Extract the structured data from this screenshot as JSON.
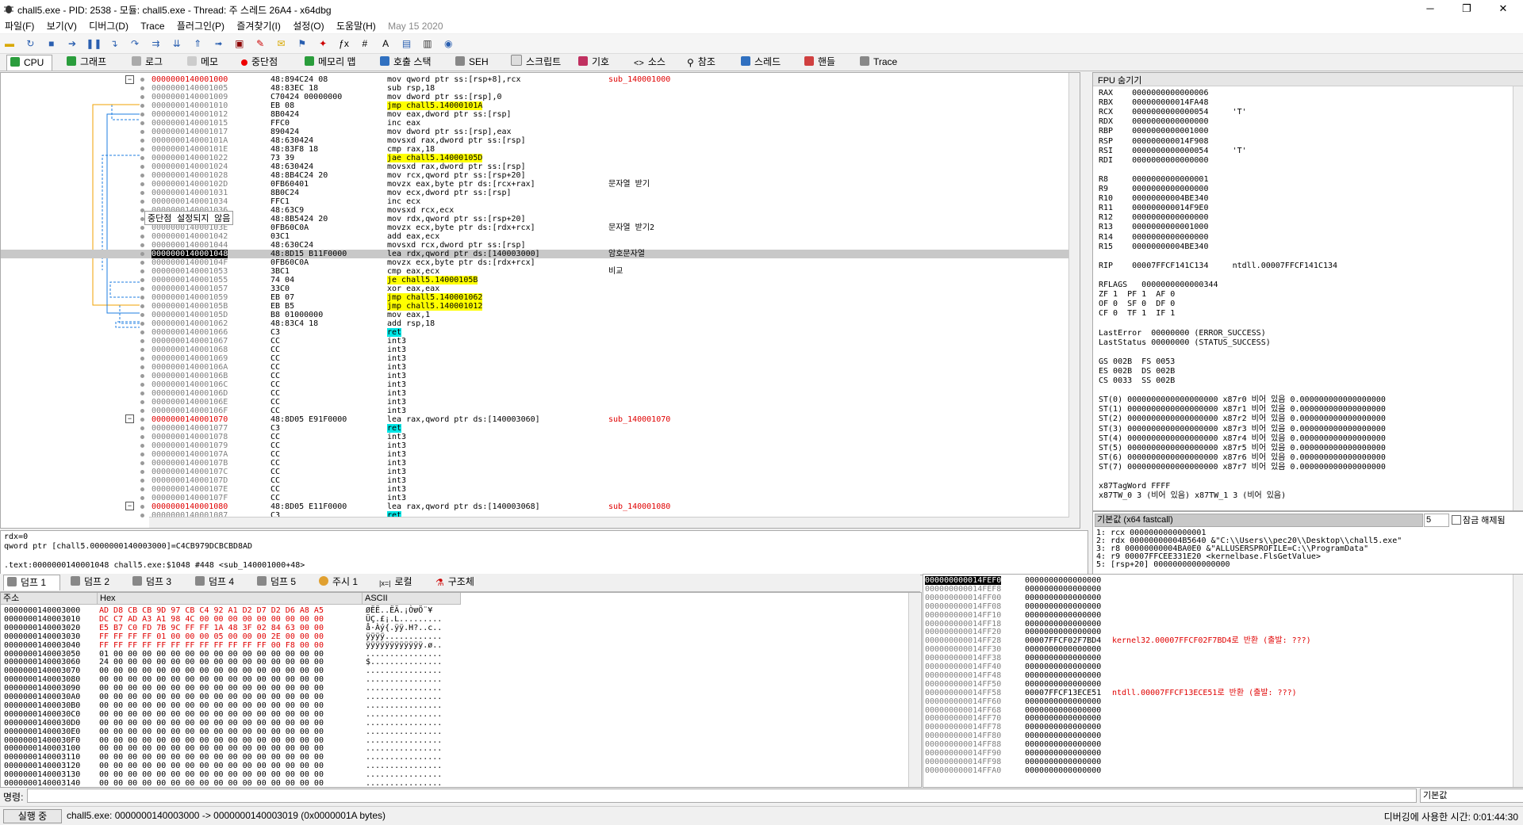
{
  "window": {
    "title": "chall5.exe - PID: 2538 - 모듈: chall5.exe - Thread: 주 스레드 26A4 - x64dbg"
  },
  "menu": [
    "파일(F)",
    "보기(V)",
    "디버그(D)",
    "Trace",
    "플러그인(P)",
    "즐겨찾기(I)",
    "설정(O)",
    "도움말(H)",
    "May 15 2020"
  ],
  "tabs": [
    "CPU",
    "그래프",
    "로그",
    "메모",
    "중단점",
    "메모리 맵",
    "호출 스택",
    "SEH",
    "스크립트",
    "기호",
    "소스",
    "참조",
    "스레드",
    "핸들",
    "Trace"
  ],
  "disasm": [
    {
      "addr": "0000000140001000",
      "bytes": "48:894C24 08",
      "instr": "mov qword ptr ss:[rsp+8],rcx",
      "cmt": "sub_140001000",
      "a": "red"
    },
    {
      "addr": "0000000140001005",
      "bytes": "48:83EC 18",
      "instr": "sub rsp,18",
      "cmt": ""
    },
    {
      "addr": "0000000140001009",
      "bytes": "C70424 00000000",
      "instr": "mov dword ptr ss:[rsp],0",
      "cmt": ""
    },
    {
      "addr": "0000000140001010",
      "bytes": "EB 08",
      "instr": "jmp chall5.14000101A",
      "cmt": "",
      "h": "yellow"
    },
    {
      "addr": "0000000140001012",
      "bytes": "8B0424",
      "instr": "mov eax,dword ptr ss:[rsp]",
      "cmt": ""
    },
    {
      "addr": "0000000140001015",
      "bytes": "FFC0",
      "instr": "inc eax",
      "cmt": ""
    },
    {
      "addr": "0000000140001017",
      "bytes": "890424",
      "instr": "mov dword ptr ss:[rsp],eax",
      "cmt": ""
    },
    {
      "addr": "000000014000101A",
      "bytes": "48:630424",
      "instr": "movsxd rax,dword ptr ss:[rsp]",
      "cmt": ""
    },
    {
      "addr": "000000014000101E",
      "bytes": "48:83F8 18",
      "instr": "cmp rax,18",
      "cmt": ""
    },
    {
      "addr": "0000000140001022",
      "bytes": "73 39",
      "instr": "jae chall5.14000105D",
      "cmt": "",
      "h": "yellow"
    },
    {
      "addr": "0000000140001024",
      "bytes": "48:630424",
      "instr": "movsxd rax,dword ptr ss:[rsp]",
      "cmt": ""
    },
    {
      "addr": "0000000140001028",
      "bytes": "48:8B4C24 20",
      "instr": "mov rcx,qword ptr ss:[rsp+20]",
      "cmt": ""
    },
    {
      "addr": "000000014000102D",
      "bytes": "0FB60401",
      "instr": "movzx eax,byte ptr ds:[rcx+rax]",
      "cmt": "문자열 받기"
    },
    {
      "addr": "0000000140001031",
      "bytes": "8B0C24",
      "instr": "mov ecx,dword ptr ss:[rsp]",
      "cmt": ""
    },
    {
      "addr": "0000000140001034",
      "bytes": "FFC1",
      "instr": "inc ecx",
      "cmt": ""
    },
    {
      "addr": "0000000140001036",
      "bytes": "48:63C9",
      "instr": "movsxd rcx,ecx",
      "cmt": ""
    },
    {
      "addr": "0000000140001039",
      "bytes": "48:8B5424 20",
      "instr": "mov rdx,qword ptr ss:[rsp+20]",
      "cmt": ""
    },
    {
      "addr": "000000014000103E",
      "bytes": "0FB60C0A",
      "instr": "movzx ecx,byte ptr ds:[rdx+rcx]",
      "cmt": "문자열 받기2"
    },
    {
      "addr": "0000000140001042",
      "bytes": "03C1",
      "instr": "add eax,ecx",
      "cmt": ""
    },
    {
      "addr": "0000000140001044",
      "bytes": "48:630C24",
      "instr": "movsxd rcx,dword ptr ss:[rsp]",
      "cmt": ""
    },
    {
      "addr": "0000000140001048",
      "bytes": "48:8D15 B11F0000",
      "instr": "lea rdx,qword ptr ds:[140003000]",
      "cmt": "암호문자열",
      "a": "blk",
      "sel": true
    },
    {
      "addr": "000000014000104F",
      "bytes": "0FB60C0A",
      "instr": "movzx ecx,byte ptr ds:[rdx+rcx]",
      "cmt": ""
    },
    {
      "addr": "0000000140001053",
      "bytes": "3BC1",
      "instr": "cmp eax,ecx",
      "cmt": "비교"
    },
    {
      "addr": "0000000140001055",
      "bytes": "74 04",
      "instr": "je chall5.14000105B",
      "cmt": "",
      "h": "yellow"
    },
    {
      "addr": "0000000140001057",
      "bytes": "33C0",
      "instr": "xor eax,eax",
      "cmt": ""
    },
    {
      "addr": "0000000140001059",
      "bytes": "EB 07",
      "instr": "jmp chall5.140001062",
      "cmt": "",
      "h": "yellow"
    },
    {
      "addr": "000000014000105B",
      "bytes": "EB B5",
      "instr": "jmp chall5.140001012",
      "cmt": "",
      "h": "yellow"
    },
    {
      "addr": "000000014000105D",
      "bytes": "B8 01000000",
      "instr": "mov eax,1",
      "cmt": ""
    },
    {
      "addr": "0000000140001062",
      "bytes": "48:83C4 18",
      "instr": "add rsp,18",
      "cmt": ""
    },
    {
      "addr": "0000000140001066",
      "bytes": "C3",
      "instr": "ret",
      "cmt": "",
      "h": "cyan"
    },
    {
      "addr": "0000000140001067",
      "bytes": "CC",
      "instr": "int3",
      "cmt": ""
    },
    {
      "addr": "0000000140001068",
      "bytes": "CC",
      "instr": "int3",
      "cmt": ""
    },
    {
      "addr": "0000000140001069",
      "bytes": "CC",
      "instr": "int3",
      "cmt": ""
    },
    {
      "addr": "000000014000106A",
      "bytes": "CC",
      "instr": "int3",
      "cmt": ""
    },
    {
      "addr": "000000014000106B",
      "bytes": "CC",
      "instr": "int3",
      "cmt": ""
    },
    {
      "addr": "000000014000106C",
      "bytes": "CC",
      "instr": "int3",
      "cmt": ""
    },
    {
      "addr": "000000014000106D",
      "bytes": "CC",
      "instr": "int3",
      "cmt": ""
    },
    {
      "addr": "000000014000106E",
      "bytes": "CC",
      "instr": "int3",
      "cmt": ""
    },
    {
      "addr": "000000014000106F",
      "bytes": "CC",
      "instr": "int3",
      "cmt": ""
    },
    {
      "addr": "0000000140001070",
      "bytes": "48:8D05 E91F0000",
      "instr": "lea rax,qword ptr ds:[140003060]",
      "cmt": "sub_140001070",
      "a": "red"
    },
    {
      "addr": "0000000140001077",
      "bytes": "C3",
      "instr": "ret",
      "cmt": "",
      "h": "cyan"
    },
    {
      "addr": "0000000140001078",
      "bytes": "CC",
      "instr": "int3",
      "cmt": ""
    },
    {
      "addr": "0000000140001079",
      "bytes": "CC",
      "instr": "int3",
      "cmt": ""
    },
    {
      "addr": "000000014000107A",
      "bytes": "CC",
      "instr": "int3",
      "cmt": ""
    },
    {
      "addr": "000000014000107B",
      "bytes": "CC",
      "instr": "int3",
      "cmt": ""
    },
    {
      "addr": "000000014000107C",
      "bytes": "CC",
      "instr": "int3",
      "cmt": ""
    },
    {
      "addr": "000000014000107D",
      "bytes": "CC",
      "instr": "int3",
      "cmt": ""
    },
    {
      "addr": "000000014000107E",
      "bytes": "CC",
      "instr": "int3",
      "cmt": ""
    },
    {
      "addr": "000000014000107F",
      "bytes": "CC",
      "instr": "int3",
      "cmt": ""
    },
    {
      "addr": "0000000140001080",
      "bytes": "48:8D05 E11F0000",
      "instr": "lea rax,qword ptr ds:[140003068]",
      "cmt": "sub_140001080",
      "a": "red"
    },
    {
      "addr": "0000000140001087",
      "bytes": "C3",
      "instr": "ret",
      "cmt": "",
      "h": "cyan"
    }
  ],
  "tooltip": "중단점 설정되지 않음",
  "info": [
    "rdx=0",
    "qword ptr [chall5.0000000140003000]=C4CB979DCBCBD8AD",
    "",
    ".text:0000000140001048 chall5.exe:$1048 #448 <sub_140001000+48>"
  ],
  "regs_header": "FPU 숨기기",
  "regs": [
    "RAX    0000000000000006",
    "RBX    000000000014FA48",
    "RCX    0000000000000054     'T'",
    "RDX    0000000000000000",
    "RBP    0000000000001000",
    "RSP    000000000014F908",
    "RSI    0000000000000054     'T'",
    "RDI    0000000000000000",
    "",
    "R8     0000000000000001",
    "R9     0000000000000000",
    "R10    00000000004BE340",
    "R11    000000000014F9E0",
    "R12    0000000000000000",
    "R13    0000000000001000",
    "R14    0000000000000000",
    "R15    00000000004BE340",
    "",
    "RIP    00007FFCF141C134     ntdll.00007FFCF141C134",
    "",
    "RFLAGS   0000000000000344",
    "ZF 1  PF 1  AF 0",
    "OF 0  SF 0  DF 0",
    "CF 0  TF 1  IF 1",
    "",
    "LastError  00000000 (ERROR_SUCCESS)",
    "LastStatus 00000000 (STATUS_SUCCESS)",
    "",
    "GS 002B  FS 0053",
    "ES 002B  DS 002B",
    "CS 0033  SS 002B",
    "",
    "ST(0) 0000000000000000000 x87r0 비어 있음 0.000000000000000000",
    "ST(1) 0000000000000000000 x87r1 비어 있음 0.000000000000000000",
    "ST(2) 0000000000000000000 x87r2 비어 있음 0.000000000000000000",
    "ST(3) 0000000000000000000 x87r3 비어 있음 0.000000000000000000",
    "ST(4) 0000000000000000000 x87r4 비어 있음 0.000000000000000000",
    "ST(5) 0000000000000000000 x87r5 비어 있음 0.000000000000000000",
    "ST(6) 0000000000000000000 x87r6 비어 있음 0.000000000000000000",
    "ST(7) 0000000000000000000 x87r7 비어 있음 0.000000000000000000",
    "",
    "x87TagWord FFFF",
    "x87TW_0 3 (비어 있음) x87TW_1 3 (비어 있음)"
  ],
  "callconv": {
    "label": "기본값 (x64 fastcall)",
    "count": "5",
    "lock": "잠금 해제됨"
  },
  "callstack": [
    "1: rcx 0000000000000001",
    "2: rdx 00000000004B5640 &\"C:\\\\Users\\\\pec20\\\\Desktop\\\\chall5.exe\"",
    "3: r8 00000000004BA0E0 &\"ALLUSERSPROFILE=C:\\\\ProgramData\"",
    "4: r9 00007FFCEE331E20 <kernelbase.FlsGetValue>",
    "5: [rsp+20] 0000000000000000"
  ],
  "dumptabs": [
    "덤프 1",
    "덤프 2",
    "덤프 3",
    "덤프 4",
    "덤프 5",
    "주시 1",
    "로컬",
    "구조체"
  ],
  "dump_headers": [
    "주소",
    "Hex",
    "ASCII"
  ],
  "dump": [
    {
      "a": "0000000140003000",
      "h": "AD D8 CB CB 9D 97 CB C4 92 A1 D2 D7 D2 D6 A8 A5",
      "s": "­ØËË..ËÄ.¡ÒשÖ¨¥"
    },
    {
      "a": "0000000140003010",
      "h": "DC C7 AD A3 A1 98 4C 00 00 00 00 00 00 00 00 00",
      "s": "ÜÇ.£¡.L........."
    },
    {
      "a": "0000000140003020",
      "h": "E5 B7 C0 FD 7B 9C FF FF 1A 48 3F 02 84 63 00 00",
      "s": "å·Àý{.ÿÿ.H?..c.."
    },
    {
      "a": "0000000140003030",
      "h": "FF FF FF FF 01 00 00 00 05 00 00 00 2E 00 00 00",
      "s": "ÿÿÿÿ............"
    },
    {
      "a": "0000000140003040",
      "h": "FF FF FF FF FF FF FF FF FF FF FF FF 00 F8 00 00",
      "s": "ÿÿÿÿÿÿÿÿÿÿÿÿ.ø.."
    },
    {
      "a": "0000000140003050",
      "h": "01 00 00 00 00 00 00 00 00 00 00 00 00 00 00 00",
      "s": "................"
    },
    {
      "a": "0000000140003060",
      "h": "24 00 00 00 00 00 00 00 00 00 00 00 00 00 00 00",
      "s": "$..............."
    },
    {
      "a": "0000000140003070",
      "h": "00 00 00 00 00 00 00 00 00 00 00 00 00 00 00 00",
      "s": "................"
    },
    {
      "a": "0000000140003080",
      "h": "00 00 00 00 00 00 00 00 00 00 00 00 00 00 00 00",
      "s": "................"
    },
    {
      "a": "0000000140003090",
      "h": "00 00 00 00 00 00 00 00 00 00 00 00 00 00 00 00",
      "s": "................"
    },
    {
      "a": "00000001400030A0",
      "h": "00 00 00 00 00 00 00 00 00 00 00 00 00 00 00 00",
      "s": "................"
    },
    {
      "a": "00000001400030B0",
      "h": "00 00 00 00 00 00 00 00 00 00 00 00 00 00 00 00",
      "s": "................"
    },
    {
      "a": "00000001400030C0",
      "h": "00 00 00 00 00 00 00 00 00 00 00 00 00 00 00 00",
      "s": "................"
    },
    {
      "a": "00000001400030D0",
      "h": "00 00 00 00 00 00 00 00 00 00 00 00 00 00 00 00",
      "s": "................"
    },
    {
      "a": "00000001400030E0",
      "h": "00 00 00 00 00 00 00 00 00 00 00 00 00 00 00 00",
      "s": "................"
    },
    {
      "a": "00000001400030F0",
      "h": "00 00 00 00 00 00 00 00 00 00 00 00 00 00 00 00",
      "s": "................"
    },
    {
      "a": "0000000140003100",
      "h": "00 00 00 00 00 00 00 00 00 00 00 00 00 00 00 00",
      "s": "................"
    },
    {
      "a": "0000000140003110",
      "h": "00 00 00 00 00 00 00 00 00 00 00 00 00 00 00 00",
      "s": "................"
    },
    {
      "a": "0000000140003120",
      "h": "00 00 00 00 00 00 00 00 00 00 00 00 00 00 00 00",
      "s": "................"
    },
    {
      "a": "0000000140003130",
      "h": "00 00 00 00 00 00 00 00 00 00 00 00 00 00 00 00",
      "s": "................"
    },
    {
      "a": "0000000140003140",
      "h": "00 00 00 00 00 00 00 00 00 00 00 00 00 00 00 00",
      "s": "................"
    }
  ],
  "stack": [
    {
      "a": "000000000014FEF0",
      "v": "0000000000000000",
      "c": ""
    },
    {
      "a": "000000000014FEF8",
      "v": "0000000000000000",
      "c": ""
    },
    {
      "a": "000000000014FF00",
      "v": "0000000000000000",
      "c": ""
    },
    {
      "a": "000000000014FF08",
      "v": "0000000000000000",
      "c": ""
    },
    {
      "a": "000000000014FF10",
      "v": "0000000000000000",
      "c": ""
    },
    {
      "a": "000000000014FF18",
      "v": "0000000000000000",
      "c": ""
    },
    {
      "a": "000000000014FF20",
      "v": "0000000000000000",
      "c": ""
    },
    {
      "a": "000000000014FF28",
      "v": "00007FFCF02F7BD4",
      "c": "kernel32.00007FFCF02F7BD4로 반환 (출발: ???)"
    },
    {
      "a": "000000000014FF30",
      "v": "0000000000000000",
      "c": ""
    },
    {
      "a": "000000000014FF38",
      "v": "0000000000000000",
      "c": ""
    },
    {
      "a": "000000000014FF40",
      "v": "0000000000000000",
      "c": ""
    },
    {
      "a": "000000000014FF48",
      "v": "0000000000000000",
      "c": ""
    },
    {
      "a": "000000000014FF50",
      "v": "0000000000000000",
      "c": ""
    },
    {
      "a": "000000000014FF58",
      "v": "00007FFCF13ECE51",
      "c": "ntdll.00007FFCF13ECE51로 반환 (출발: ???)"
    },
    {
      "a": "000000000014FF60",
      "v": "0000000000000000",
      "c": ""
    },
    {
      "a": "000000000014FF68",
      "v": "0000000000000000",
      "c": ""
    },
    {
      "a": "000000000014FF70",
      "v": "0000000000000000",
      "c": ""
    },
    {
      "a": "000000000014FF78",
      "v": "0000000000000000",
      "c": ""
    },
    {
      "a": "000000000014FF80",
      "v": "0000000000000000",
      "c": ""
    },
    {
      "a": "000000000014FF88",
      "v": "0000000000000000",
      "c": ""
    },
    {
      "a": "000000000014FF90",
      "v": "0000000000000000",
      "c": ""
    },
    {
      "a": "000000000014FF98",
      "v": "0000000000000000",
      "c": ""
    },
    {
      "a": "000000000014FFA0",
      "v": "0000000000000000",
      "c": ""
    }
  ],
  "command": {
    "label": "명령:",
    "default": "기본값"
  },
  "status": {
    "state": "실행 중",
    "msg": "chall5.exe: 0000000140003000 -> 0000000140003019 (0x0000001A bytes)",
    "time": "디버깅에 사용한 시간: 0:01:44:30"
  }
}
